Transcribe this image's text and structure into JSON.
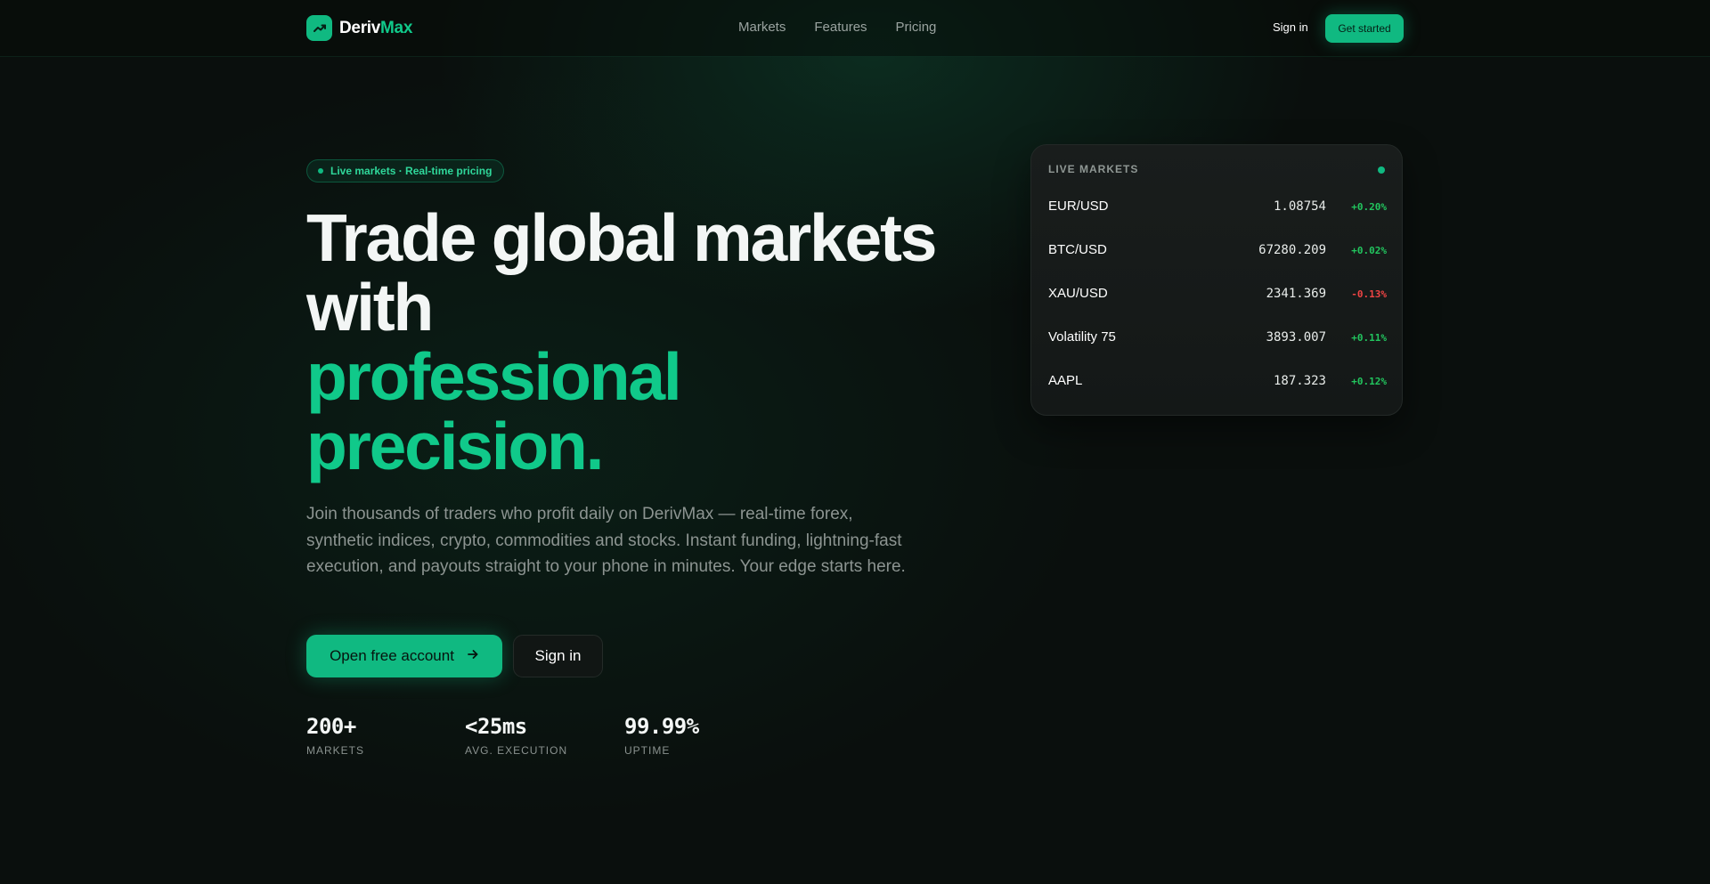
{
  "brand": {
    "name_part1": "Deriv",
    "name_part2": "Max",
    "accent": "#10b981"
  },
  "nav": {
    "links": [
      "Markets",
      "Features",
      "Pricing"
    ],
    "sign_in": "Sign in",
    "cta": "Get started"
  },
  "hero": {
    "pill": "Live markets · Real-time pricing",
    "headline_lines": [
      "Trade global markets",
      "with"
    ],
    "headline_accent_lines": [
      "professional",
      "precision."
    ],
    "subtext": "Join thousands of traders who profit daily on DerivMax — real-time forex, synthetic indices, crypto, commodities and stocks. Instant funding, lightning-fast execution, and payouts straight to your phone in minutes. Your edge starts here.",
    "primary_button": "Open free account",
    "primary_button_icon": "arrow-right-icon",
    "secondary_button": "Sign in"
  },
  "stats": [
    {
      "value": "200+",
      "label": "MARKETS"
    },
    {
      "value": "<25ms",
      "label": "AVG. EXECUTION"
    },
    {
      "value": "99.99%",
      "label": "UPTIME"
    }
  ],
  "live_markets": {
    "title": "LIVE MARKETS",
    "rows": [
      {
        "name": "EUR/USD",
        "price": "1.08754",
        "change": "+0.20%",
        "direction": "up"
      },
      {
        "name": "BTC/USD",
        "price": "67280.209",
        "change": "+0.02%",
        "direction": "up"
      },
      {
        "name": "XAU/USD",
        "price": "2341.369",
        "change": "-0.13%",
        "direction": "down"
      },
      {
        "name": "Volatility 75",
        "price": "3893.007",
        "change": "+0.11%",
        "direction": "up"
      },
      {
        "name": "AAPL",
        "price": "187.323",
        "change": "+0.12%",
        "direction": "up"
      }
    ],
    "colors": {
      "up": "#22c55e",
      "down": "#ef4444"
    }
  }
}
